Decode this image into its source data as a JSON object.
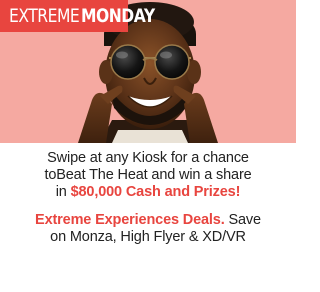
{
  "promo": {
    "title_part1": "EXTREME",
    "title_part2": "MONDAY",
    "hero_image_icon": "celebrating-man-with-sunglasses-photo",
    "body": {
      "line1": "Swipe at any Kiosk for a chance",
      "line2": "toBeat The Heat and win a share",
      "line3_prefix": "in ",
      "line3_highlight": "$80,000 Cash and Prizes!",
      "deals_highlight": "Extreme Experiences Deals.",
      "deals_suffix": " Save",
      "deals_line2": "on Monza, High Flyer & XD/VR"
    }
  },
  "colors": {
    "accent": "#e8453f",
    "hero_background": "#f4a59d",
    "text": "#222222",
    "skin": "#5a3418"
  }
}
